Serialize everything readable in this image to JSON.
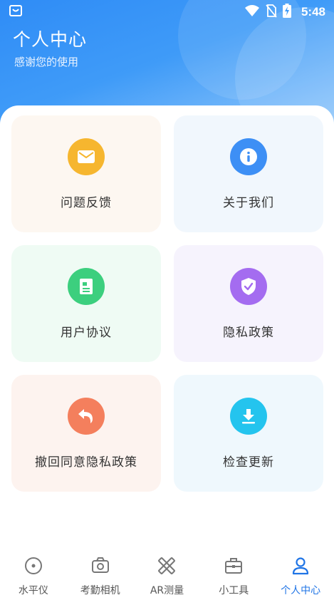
{
  "status_bar": {
    "time": "5:48",
    "icons": [
      "app-notification-icon",
      "wifi-icon",
      "no-sim-icon",
      "battery-charging-icon"
    ]
  },
  "header": {
    "title": "个人中心",
    "subtitle": "感谢您的使用"
  },
  "cards": [
    {
      "label": "问题反馈",
      "icon": "mail-icon",
      "color": "#f6b62f"
    },
    {
      "label": "关于我们",
      "icon": "info-icon",
      "color": "#3d8ff5"
    },
    {
      "label": "用户协议",
      "icon": "document-icon",
      "color": "#3ccf7e"
    },
    {
      "label": "隐私政策",
      "icon": "shield-check-icon",
      "color": "#a46cf0"
    },
    {
      "label": "撤回同意隐私政策",
      "icon": "undo-icon",
      "color": "#f47f5d"
    },
    {
      "label": "检查更新",
      "icon": "download-icon",
      "color": "#24c4ee"
    }
  ],
  "tabbar": {
    "items": [
      {
        "label": "水平仪",
        "icon": "level-icon",
        "active": false
      },
      {
        "label": "考勤相机",
        "icon": "camera-icon",
        "active": false
      },
      {
        "label": "AR测量",
        "icon": "ruler-icon",
        "active": false
      },
      {
        "label": "小工具",
        "icon": "toolbox-icon",
        "active": false
      },
      {
        "label": "个人中心",
        "icon": "person-icon",
        "active": true
      }
    ],
    "active_color": "#1f74e6"
  }
}
